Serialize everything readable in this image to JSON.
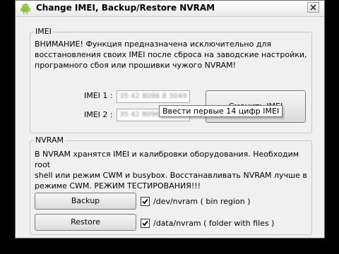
{
  "window": {
    "title": "Change IMEI, Backup/Restore NVRAM"
  },
  "imei_group": {
    "title": "IMEI",
    "notice": [
      "ВНИМАНИЕ!  Функция предназначена исключительно для",
      "восстановления своих IMEI после сброса на заводские настройки,",
      "програмного сбоя  или прошивки чужого NVRAM!"
    ],
    "imei1_label": "IMEI 1 :",
    "imei1_value": "35 42 8096 8 3049",
    "imei2_label": "IMEI 2 :",
    "imei2_value": "35 42 8096 8 3056",
    "change_button_label": "Сменить IMEI",
    "tooltip": "Ввести первые 14 цифр IMEI"
  },
  "nvram_group": {
    "title": "NVRAM",
    "notice": [
      "В NVRAM хранятся IMEI и калибровки оборудования. Необходим root",
      "shell или режим CWM и busybox. Восстанавливать NVRAM лучше в",
      "режиме CWM.  РЕЖИМ ТЕСТИРОВАНИЯ!!!"
    ],
    "backup_label": "Backup",
    "restore_label": "Restore",
    "backup_option": {
      "label": "/dev/nvram  ( bin region )",
      "checked": true
    },
    "restore_option": {
      "label": "/data/nvram  ( folder with files )",
      "checked": true
    }
  },
  "colors": {
    "window_bg": "#f0f0f0",
    "frame": "#6b6b6b",
    "android_green": "#8ec63f"
  }
}
